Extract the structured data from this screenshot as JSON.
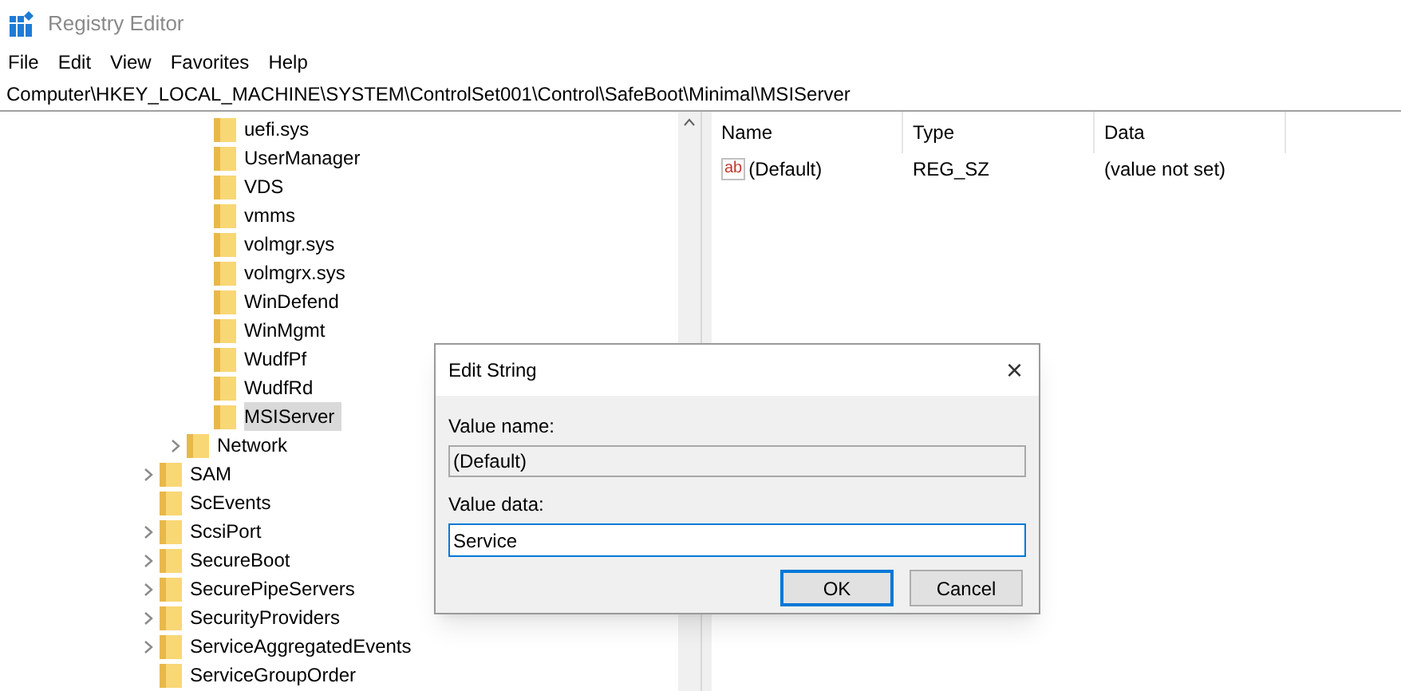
{
  "window": {
    "title": "Registry Editor"
  },
  "menu": [
    "File",
    "Edit",
    "View",
    "Favorites",
    "Help"
  ],
  "address": "Computer\\HKEY_LOCAL_MACHINE\\SYSTEM\\ControlSet001\\Control\\SafeBoot\\Minimal\\MSIServer",
  "tree": {
    "items": [
      {
        "children": [
          {
            "children": [
              {
                "label": "uefi.sys",
                "expandable": false,
                "selected": false
              },
              {
                "label": "UserManager",
                "expandable": false,
                "selected": false
              },
              {
                "label": "VDS",
                "expandable": false,
                "selected": false
              },
              {
                "label": "vmms",
                "expandable": false,
                "selected": false
              },
              {
                "label": "volmgr.sys",
                "expandable": false,
                "selected": false
              },
              {
                "label": "volmgrx.sys",
                "expandable": false,
                "selected": false
              },
              {
                "label": "WinDefend",
                "expandable": false,
                "selected": false
              },
              {
                "label": "WinMgmt",
                "expandable": false,
                "selected": false
              },
              {
                "label": "WudfPf",
                "expandable": false,
                "selected": false
              },
              {
                "label": "WudfRd",
                "expandable": false,
                "selected": false
              },
              {
                "label": "MSIServer",
                "expandable": false,
                "selected": true
              }
            ]
          },
          {
            "label": "Network",
            "expandable": true,
            "selected": false
          }
        ]
      },
      {
        "label": "SAM",
        "expandable": true,
        "selected": false
      },
      {
        "label": "ScEvents",
        "expandable": false,
        "selected": false
      },
      {
        "label": "ScsiPort",
        "expandable": true,
        "selected": false
      },
      {
        "label": "SecureBoot",
        "expandable": true,
        "selected": false
      },
      {
        "label": "SecurePipeServers",
        "expandable": true,
        "selected": false
      },
      {
        "label": "SecurityProviders",
        "expandable": true,
        "selected": false
      },
      {
        "label": "ServiceAggregatedEvents",
        "expandable": true,
        "selected": false
      },
      {
        "label": "ServiceGroupOrder",
        "expandable": false,
        "selected": false
      }
    ]
  },
  "values": {
    "columns": [
      "Name",
      "Type",
      "Data"
    ],
    "rows": [
      {
        "type_icon": "ab",
        "name": "(Default)",
        "type": "REG_SZ",
        "data": "(value not set)"
      }
    ]
  },
  "dialog": {
    "title": "Edit String",
    "close": "×",
    "value_name_label": "Value name:",
    "value_name": "(Default)",
    "value_data_label": "Value data:",
    "value_data": "Service",
    "buttons": [
      {
        "label": "OK",
        "default": true
      },
      {
        "label": "Cancel",
        "default": false
      }
    ]
  }
}
